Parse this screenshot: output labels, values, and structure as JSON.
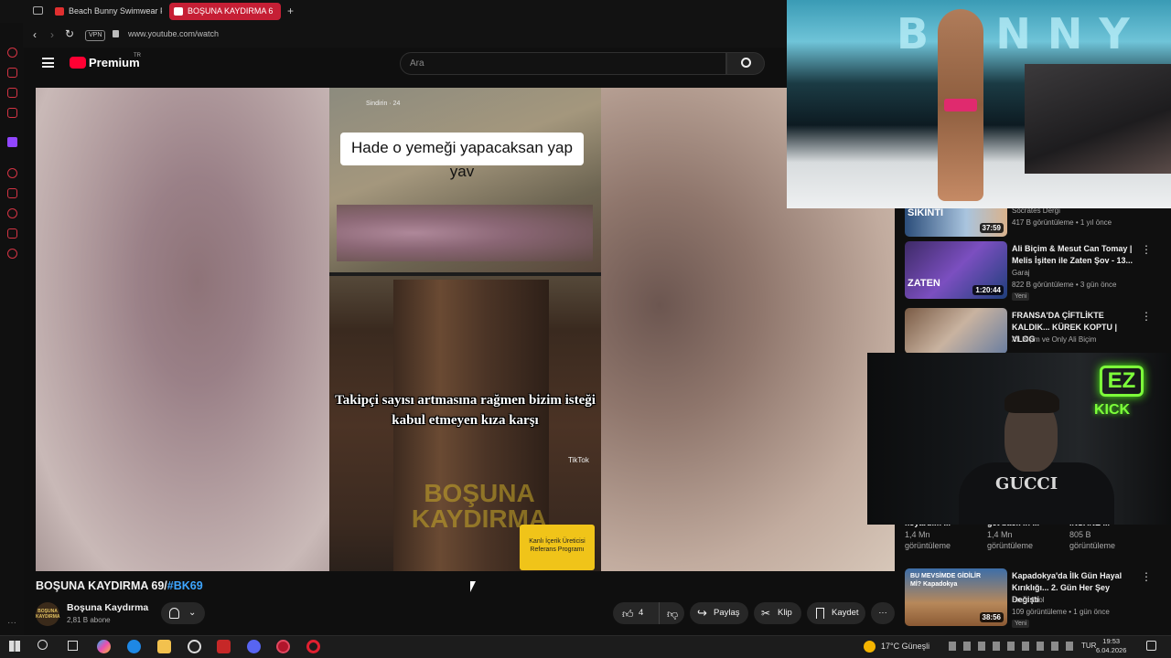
{
  "browser": {
    "tabs": [
      {
        "label": "Beach Bunny Swimwear F"
      },
      {
        "label": "BOŞUNA KAYDIRMA 6"
      }
    ],
    "new_tab": "+",
    "vpn": "VPN",
    "url": "www.youtube.com/watch"
  },
  "youtube": {
    "logo_text": "Premium",
    "logo_badge": "TR",
    "search_placeholder": "Ara"
  },
  "video": {
    "top_info": "Sindirin · 24",
    "caption_top": "Hade o yemeği yapacaksan yap yav",
    "caption_bottom": "Takipçi sayısı artmasına rağmen bizim isteği kabul etmeyen kıza karşı",
    "watermark": "BOŞUNA KAYDIRMA",
    "tiktok": "TikTok",
    "badge": "Kanlı İçerik Üreticisi Referans Programı"
  },
  "title": {
    "text": "BOŞUNA KAYDIRMA 69/",
    "hashtag": "#BK69"
  },
  "channel": {
    "avatar_text": "BOŞUNA KAYDIRMA",
    "name": "Boşuna Kaydırma",
    "subs": "2,81 B abone"
  },
  "actions": {
    "likes": "4",
    "share": "Paylaş",
    "clip": "Klip",
    "save": "Kaydet",
    "more": "···"
  },
  "recommendations": [
    {
      "thumb_text": "SIKINTI",
      "duration": "37:59",
      "channel": "Socrates Dergi",
      "meta": "417 B görüntüleme • 1 yıl önce"
    },
    {
      "title": "Ali Biçim & Mesut Can Tomay | Melis İşiten ile Zaten Şov - 13...",
      "thumb_text": "ZATEN",
      "duration": "1:20:44",
      "channel": "Garaj",
      "meta": "822 B görüntüleme • 3 gün önce",
      "badge": "Yeni"
    },
    {
      "title": "FRANSA'DA ÇİFTLİKTE KALDIK... KÜREK KOPTU | VLOG",
      "channel": "Ali Biçim ve Only Ali Biçim",
      "meta": "124 B görüntüleme • 2 gün önce"
    },
    {
      "title": "Kapadokya'da İlk Gün Hayal Kırıklığı... 2. Gün Her Şey Değişti",
      "thumb_text": "BU MEVSİMDE GİDİLİR Mİ? Kapadokya",
      "duration": "38:56",
      "channel": "Emre Erol",
      "meta": "109 görüntüleme • 1 gün önce",
      "badge": "Yeni"
    }
  ],
  "grid_row": [
    {
      "title": "koyardım ...",
      "views": "1,4 Mn",
      "label": "görüntüleme"
    },
    {
      "title": "get back in ...",
      "views": "1,4 Mn",
      "label": "görüntüleme"
    },
    {
      "title": "İNSANE ...",
      "views": "805 B",
      "label": "görüntüleme"
    }
  ],
  "overlays": {
    "pip_brand": "BUNNY",
    "cam_shirt": "GUCCI",
    "ez_badge": "EZ",
    "kick_label": "KICK"
  },
  "taskbar": {
    "weather": "17°C Güneşli",
    "lang": "TUR",
    "time": "19:53",
    "date": "6.04.2026"
  }
}
